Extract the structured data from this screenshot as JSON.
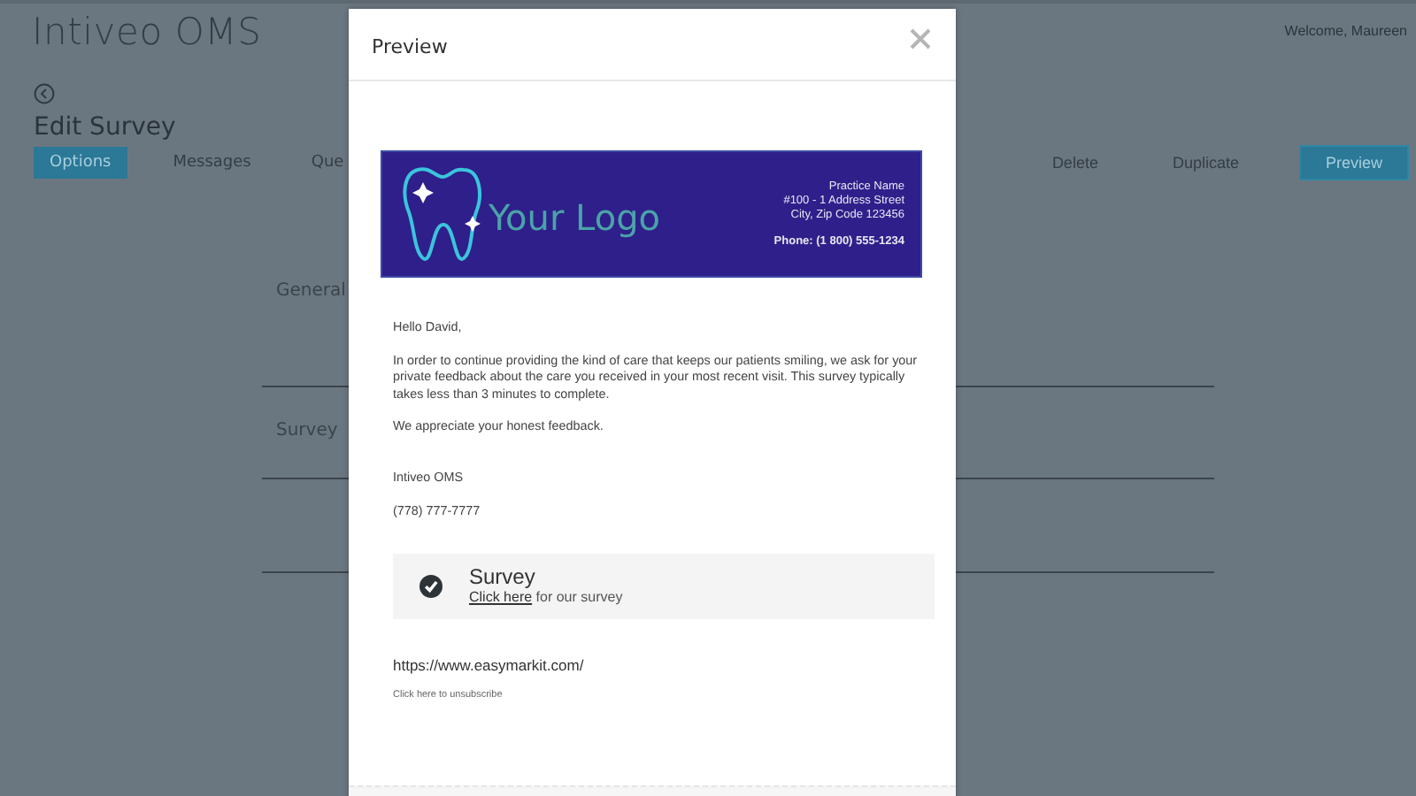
{
  "app": {
    "title": "Intiveo OMS",
    "user": "Welcome, Maureen"
  },
  "page": {
    "heading": "Edit Survey",
    "tabs": [
      {
        "label": "Options",
        "selected": true
      },
      {
        "label": "Messages",
        "selected": false
      },
      {
        "label": "Que",
        "selected": false
      }
    ],
    "actions": [
      {
        "label": "Delete",
        "kind": "plain"
      },
      {
        "label": "Duplicate",
        "kind": "plain"
      },
      {
        "label": "Preview",
        "kind": "primary"
      }
    ],
    "sections": [
      "General",
      "Survey"
    ]
  },
  "dialog": {
    "title": "Preview",
    "banner": {
      "logo_text": "Your Logo",
      "practice_lines": [
        "Practice Name",
        "#100 - 1 Address Street",
        "City, Zip Code 123456"
      ],
      "phone": "Phone: (1 800) 555-1234"
    },
    "greeting": "Hello David,",
    "paragraphs": [
      "In order to continue providing the kind of care that keeps our patients smiling, we ask for your private feedback about the care you received in your most recent visit. This survey typically takes less than 3 minutes to complete.",
      "We appreciate your honest feedback."
    ],
    "signature": [
      "Intiveo OMS",
      "(778) 777-7777"
    ],
    "survey_card": {
      "title": "Survey",
      "link": "Click here",
      "text": "for our survey"
    },
    "website": "https://www.easymarkit.com/",
    "unsubscribe": "Click here to unsubscribe"
  }
}
